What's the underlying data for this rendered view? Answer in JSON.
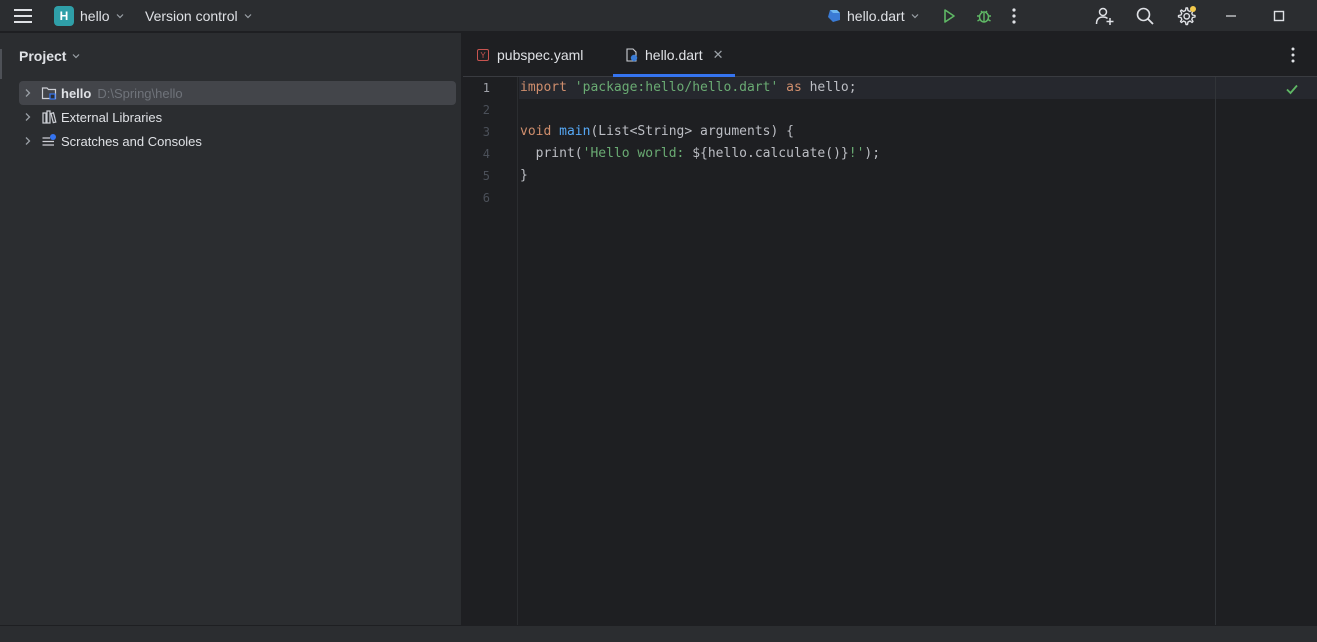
{
  "titlebar": {
    "project_initial": "H",
    "project_name": "hello",
    "vcs_label": "Version control",
    "run_config": "hello.dart"
  },
  "project_panel": {
    "title": "Project",
    "tree": [
      {
        "label": "hello",
        "path": "D:\\Spring\\hello",
        "icon": "folder-module-icon"
      },
      {
        "label": "External Libraries",
        "icon": "library-icon"
      },
      {
        "label": "Scratches and Consoles",
        "icon": "scratches-icon"
      }
    ]
  },
  "editor": {
    "tabs": [
      {
        "label": "pubspec.yaml",
        "icon": "yaml-file-icon"
      },
      {
        "label": "hello.dart",
        "icon": "dart-file-icon",
        "active": true
      }
    ],
    "line_numbers": [
      "1",
      "2",
      "3",
      "4",
      "5",
      "6"
    ],
    "code": {
      "line1": {
        "kw1": "import",
        "str": "'package:hello/hello.dart'",
        "kw2": "as",
        "rest": "hello;"
      },
      "line3": {
        "kw": "void",
        "fn": "main",
        "rest": "(List<String> arguments) {"
      },
      "line4": {
        "pre": "  print(",
        "str1": "'Hello world: ",
        "interp": "${hello.calculate()}",
        "str2": "!'",
        "post": ");"
      },
      "line5": "}"
    }
  },
  "colors": {
    "accent": "#3574f0",
    "keyword": "#cf8e6d",
    "string": "#6aab73",
    "function": "#56a8f5",
    "run_green": "#5fb865",
    "project_badge": "#2f9fa8"
  }
}
